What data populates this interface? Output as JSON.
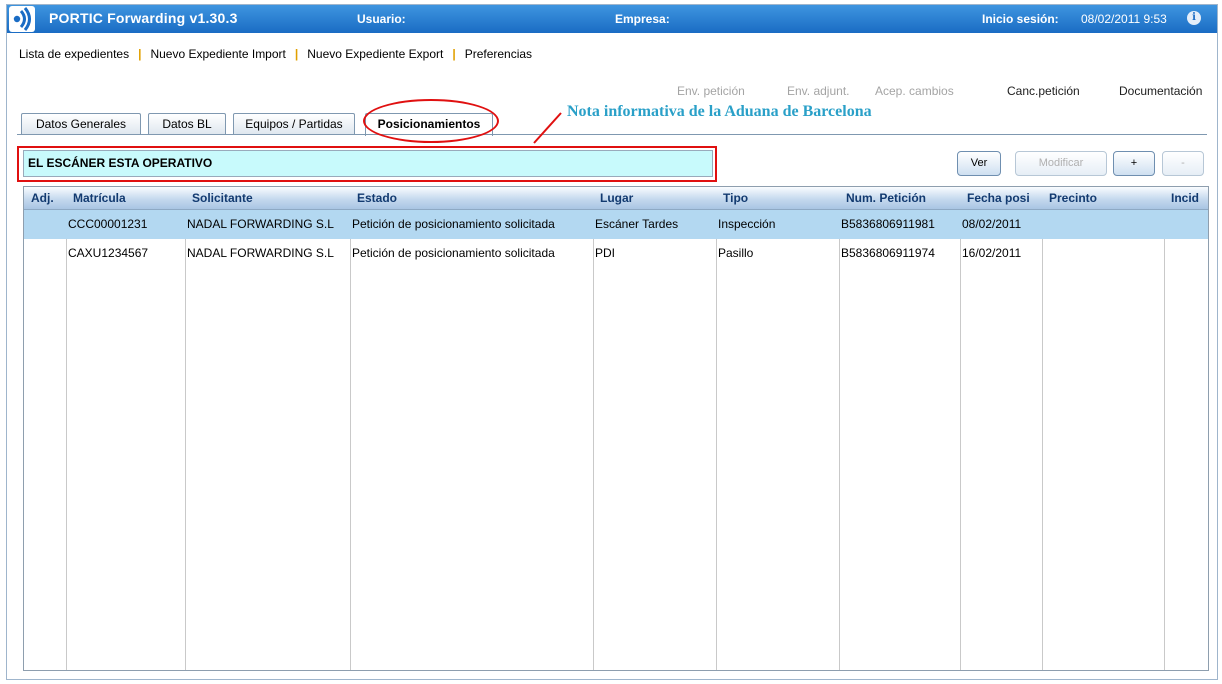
{
  "header": {
    "app_title": "PORTIC Forwarding v1.30.3",
    "user_label": "Usuario:",
    "company_label": "Empresa:",
    "session_label": "Inicio sesión:",
    "session_value": "08/02/2011 9:53",
    "info_icon": "i",
    "brand_color": "#1a6cc4"
  },
  "topmenu": {
    "items": [
      "Lista de expedientes",
      "Nuevo Expediente Import",
      "Nuevo Expediente Export",
      "Preferencias"
    ],
    "separator": "|"
  },
  "actions": {
    "env_peticion": "Env. petición",
    "env_adjunt": "Env. adjunt.",
    "acep_cambios": "Acep. cambios",
    "canc_peticion": "Canc.petición",
    "documentacion": "Documentación"
  },
  "tabs": [
    "Datos Generales",
    "Datos BL",
    "Equipos / Partidas",
    "Posicionamientos"
  ],
  "active_tab": "Posicionamientos",
  "annotation": {
    "text": "Nota informativa de la Aduana de Barcelona",
    "color": "#e01010"
  },
  "note": {
    "text": "EL ESCÁNER ESTA OPERATIVO",
    "background": "#c8fafc"
  },
  "buttons": {
    "ver": "Ver",
    "modificar": "Modificar",
    "add": "+",
    "remove": "-"
  },
  "grid": {
    "columns": [
      "Adj.",
      "Matrícula",
      "Solicitante",
      "Estado",
      "Lugar",
      "Tipo",
      "Num. Petición",
      "Fecha posi",
      "Precinto",
      "Incid"
    ],
    "rows": [
      {
        "adj": "",
        "matricula": "CCC00001231",
        "solicitante": "NADAL FORWARDING S.L",
        "estado": "Petición de posicionamiento solicitada",
        "lugar": "Escáner Tardes",
        "tipo": "Inspección",
        "num_peticion": "B5836806911981",
        "fecha": "08/02/2011",
        "precinto": "",
        "incid": "",
        "selected": true
      },
      {
        "adj": "",
        "matricula": "CAXU1234567",
        "solicitante": "NADAL FORWARDING S.L",
        "estado": "Petición de posicionamiento solicitada",
        "lugar": "PDI",
        "tipo": "Pasillo",
        "num_peticion": "B5836806911974",
        "fecha": "16/02/2011",
        "precinto": "",
        "incid": "",
        "selected": false
      }
    ]
  }
}
